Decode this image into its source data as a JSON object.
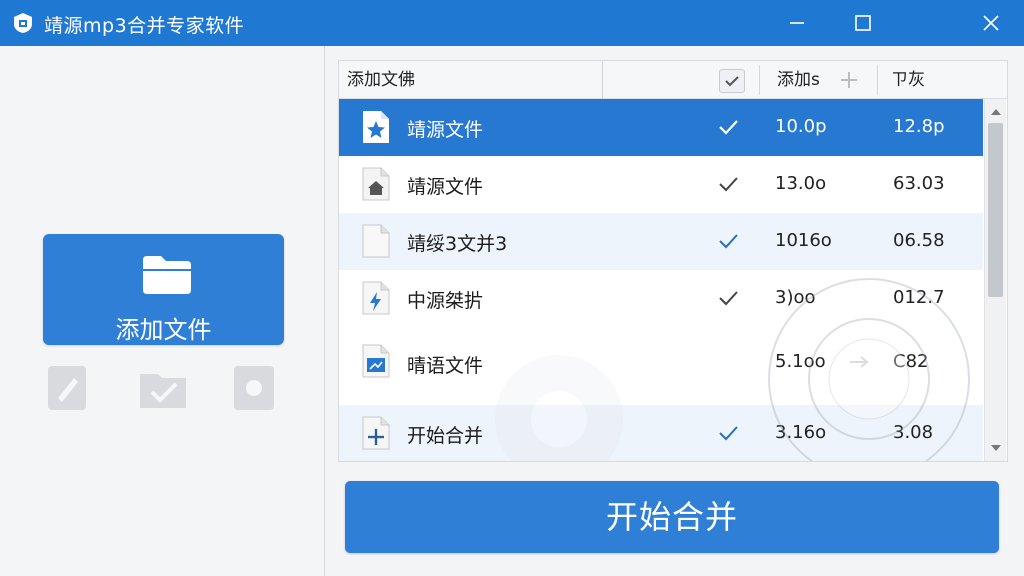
{
  "window": {
    "title": "靖源mp3合并专家软件",
    "accent": "#1f78d1"
  },
  "left_panel": {
    "add_button_label": "添加文件"
  },
  "file_list": {
    "columns": {
      "name": "添加文佛",
      "size": "添加s",
      "status": "ㄗ灰"
    },
    "rows": [
      {
        "icon": "star-file-icon",
        "name": "靖源文件",
        "checked": true,
        "size": "10.0p",
        "time": "12.8p",
        "selected": true
      },
      {
        "icon": "home-file-icon",
        "name": "靖源文件",
        "checked": true,
        "size": "13.0o",
        "time": "63.03",
        "selected": false
      },
      {
        "icon": "blank-file-icon",
        "name": "靖绥3文并3",
        "checked": true,
        "size": "1016o",
        "time": "06.58",
        "selected": false
      },
      {
        "icon": "lightning-file-icon",
        "name": "中源桀扸",
        "checked": true,
        "size": "3)oo",
        "time": "012.7",
        "selected": false
      },
      {
        "icon": "image-file-icon",
        "name": "晴语文件",
        "checked": false,
        "size": "5.1oo",
        "time": "C82",
        "selected": false
      },
      {
        "icon": "plus-file-icon",
        "name": "开始合并",
        "checked": true,
        "size": "3.16o",
        "time": "3.08",
        "selected": false
      }
    ]
  },
  "merge_button_label": "开始合并"
}
